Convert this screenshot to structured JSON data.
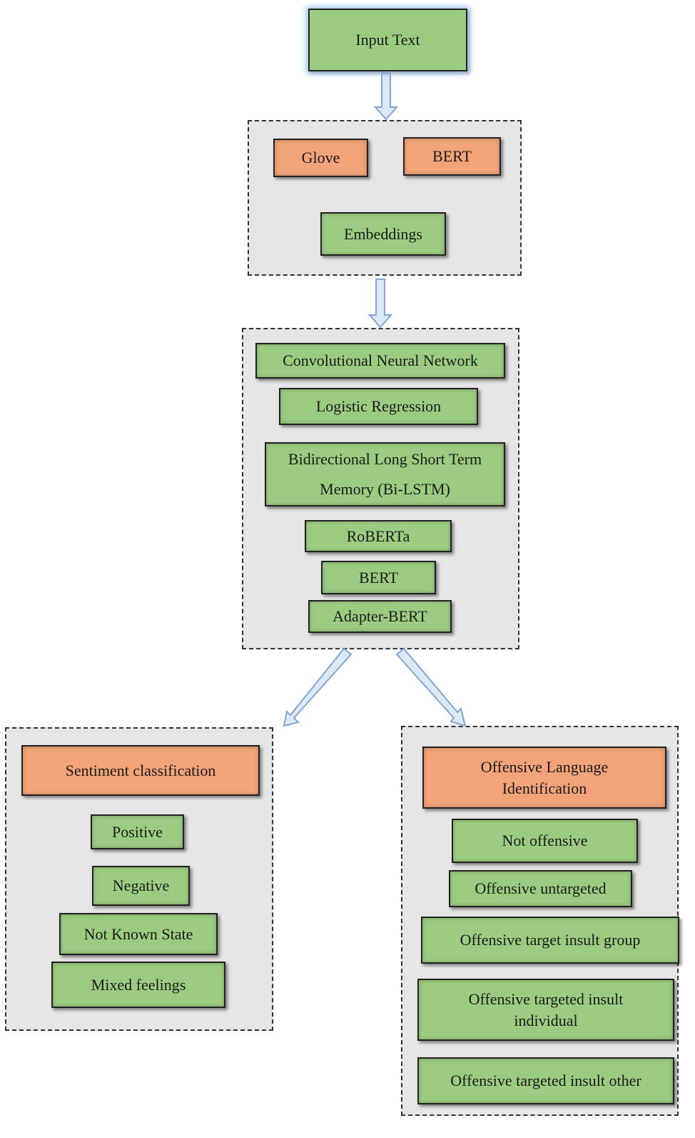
{
  "input": "Input Text",
  "embedding_group": {
    "items": [
      "Glove",
      "BERT"
    ],
    "output": "Embeddings"
  },
  "models": [
    "Convolutional Neural Network",
    "Logistic Regression",
    "Bidirectional Long Short Term Memory (Bi-LSTM)",
    "RoBERTa",
    "BERT",
    "Adapter-BERT"
  ],
  "sentiment": {
    "title": "Sentiment classification",
    "classes": [
      "Positive",
      "Negative",
      "Not Known State",
      "Mixed feelings"
    ]
  },
  "offensive": {
    "title": "Offensive Language Identification",
    "classes": [
      "Not offensive",
      "Offensive untargeted",
      "Offensive target insult group",
      "Offensive targeted insult individual",
      "Offensive targeted insult other"
    ]
  },
  "colors": {
    "green": "#9ccc82",
    "orange": "#f3a478",
    "group_bg": "#e6e6e6",
    "arrow": "#9ec3e6"
  }
}
